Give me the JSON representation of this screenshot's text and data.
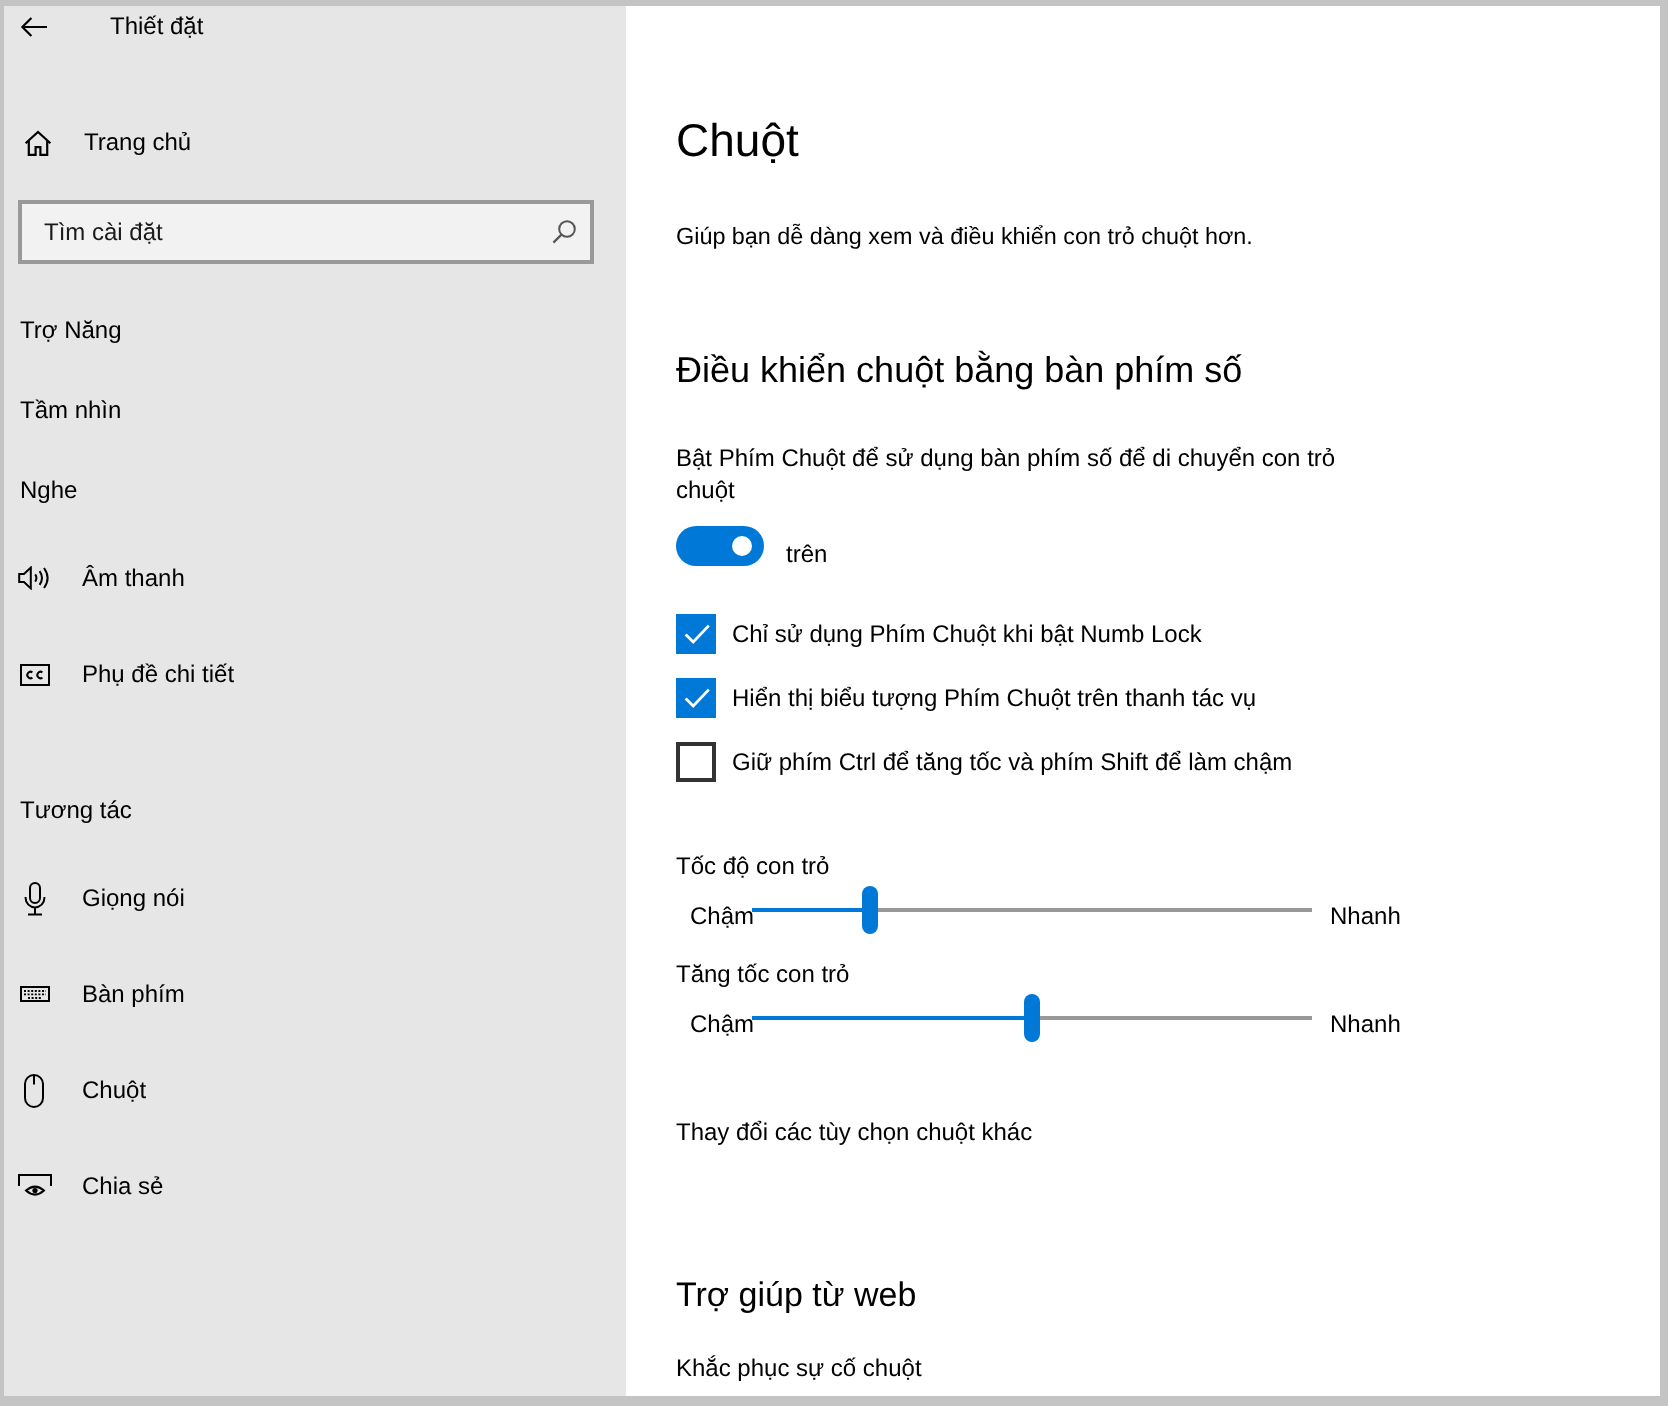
{
  "window": {
    "title": "Thiết đặt"
  },
  "sidebar": {
    "home": "Trang chủ",
    "search": {
      "placeholder": "Tìm cài đặt"
    },
    "category": "Trợ Năng",
    "entries": [
      {
        "kind": "heading",
        "label": "Tầm nhìn"
      },
      {
        "kind": "heading",
        "label": "Nghe"
      },
      {
        "kind": "item",
        "label": "Âm thanh"
      },
      {
        "kind": "item",
        "label": "Phụ đề chi tiết"
      },
      {
        "kind": "heading",
        "label": "Tương tác"
      },
      {
        "kind": "item",
        "label": "Giọng nói"
      },
      {
        "kind": "item",
        "label": "Bàn phím"
      },
      {
        "kind": "item",
        "label": "Chuột"
      },
      {
        "kind": "item",
        "label": "Chia sẻ"
      }
    ]
  },
  "page": {
    "title": "Chuột",
    "description": "Giúp bạn dễ dàng xem và điều khiển con trỏ chuột hơn.",
    "mouse_keys": {
      "heading": "Điều khiển chuột bằng bàn phím số",
      "toggle": {
        "label": "Bật Phím Chuột để sử dụng bàn phím số để di chuyển con trỏ chuột",
        "on": true,
        "state_text": "trên"
      },
      "checkboxes": [
        {
          "label": "Chỉ sử dụng Phím Chuột khi bật Numb Lock",
          "checked": true
        },
        {
          "label": "Hiển thị biểu tượng Phím Chuột trên thanh tác vụ",
          "checked": true
        },
        {
          "label": "Giữ phím Ctrl để tăng tốc và phím Shift để làm chậm",
          "checked": false
        }
      ],
      "sliders": [
        {
          "label": "Tốc độ con trỏ",
          "min_label": "Chậm",
          "max_label": "Nhanh",
          "level": 0.21
        },
        {
          "label": "Tăng tốc con trỏ",
          "min_label": "Chậm",
          "max_label": "Nhanh",
          "level": 0.5
        }
      ],
      "link": "Thay đổi các tùy chọn chuột khác"
    },
    "web_help": {
      "heading": "Trợ giúp từ web",
      "links": [
        "Khắc phục sự cố chuột"
      ]
    }
  }
}
